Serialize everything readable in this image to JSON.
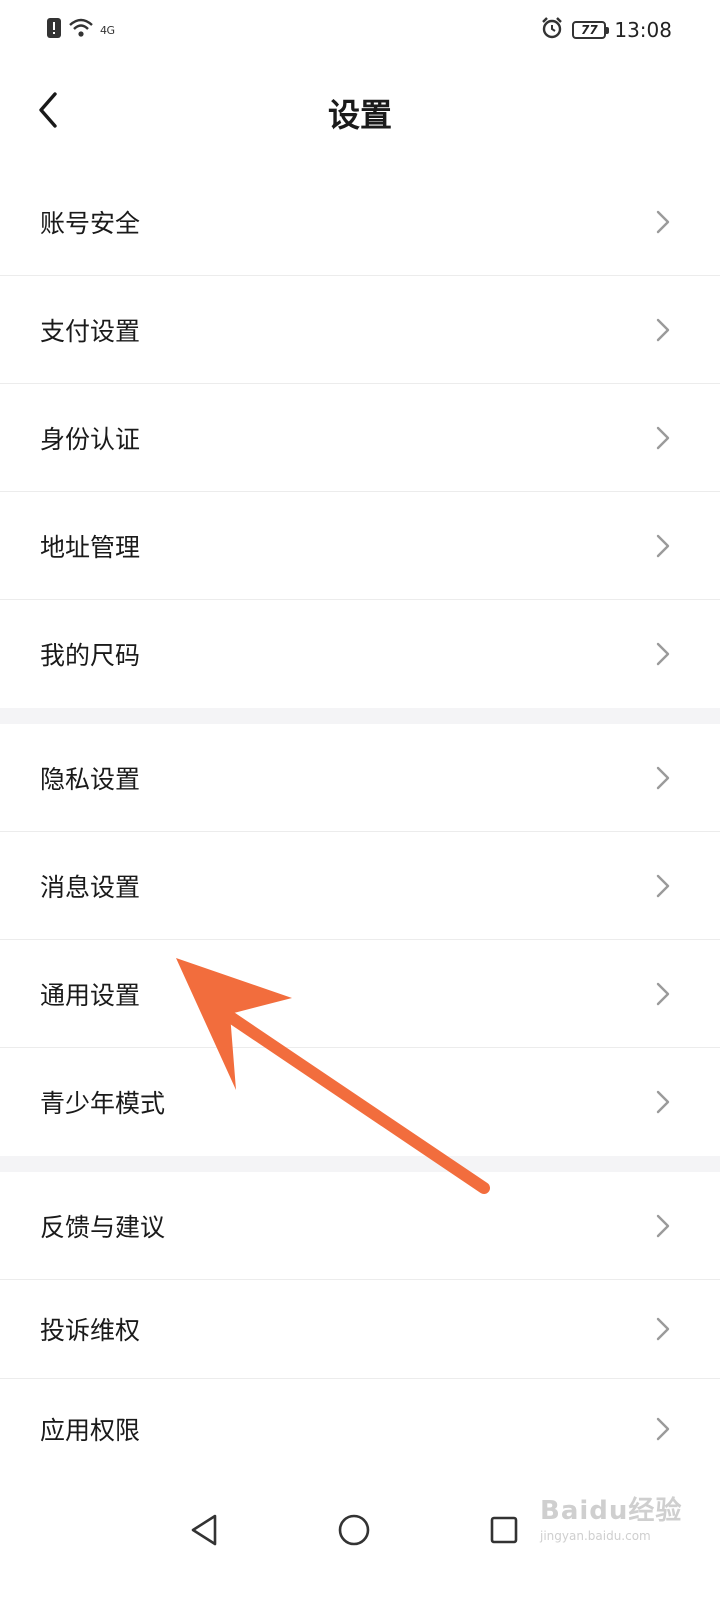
{
  "status_bar": {
    "left_icons": [
      "alert-icon",
      "wifi-icon"
    ],
    "network_text": "4G",
    "battery_level": "77",
    "time": "13:08",
    "right_icons": [
      "alarm-icon",
      "battery-icon"
    ]
  },
  "header": {
    "title": "设置",
    "back_icon": "chevron-left-icon"
  },
  "sections": [
    {
      "items": [
        {
          "label": "账号安全"
        },
        {
          "label": "支付设置"
        },
        {
          "label": "身份认证"
        },
        {
          "label": "地址管理"
        },
        {
          "label": "我的尺码"
        }
      ]
    },
    {
      "items": [
        {
          "label": "隐私设置"
        },
        {
          "label": "消息设置"
        },
        {
          "label": "通用设置"
        },
        {
          "label": "青少年模式"
        }
      ]
    },
    {
      "items": [
        {
          "label": "反馈与建议"
        },
        {
          "label": "投诉维权"
        },
        {
          "label": "应用权限"
        }
      ]
    }
  ],
  "annotation": {
    "type": "arrow",
    "color": "#f26d3d",
    "points_to": "通用设置"
  },
  "system_nav": {
    "icons": [
      "back-triangle-icon",
      "home-circle-icon",
      "recents-square-icon"
    ]
  },
  "watermark": {
    "main": "Baidu经验",
    "sub": "jingyan.baidu.com"
  },
  "colors": {
    "background": "#ffffff",
    "section_gap": "#f4f4f6",
    "divider": "#ececec",
    "chevron": "#9a9a9a",
    "arrow": "#f26d3d"
  }
}
